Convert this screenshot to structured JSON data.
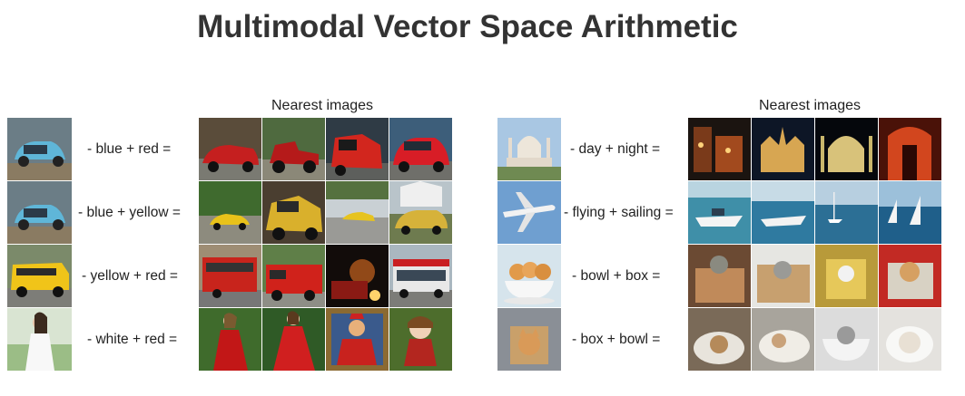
{
  "title": "Multimodal Vector Space Arithmetic",
  "panels": [
    {
      "header": "Nearest images",
      "rows": [
        {
          "query_icon": "blue-car-photo",
          "expression": "- blue + red =",
          "results": [
            "red-classic-car-photo",
            "red-hotrod-photo",
            "red-truck-photo",
            "red-hatchback-photo"
          ]
        },
        {
          "query_icon": "blue-car-photo",
          "expression": "- blue + yellow =",
          "results": [
            "yellow-car-forest-photo",
            "yellow-vintage-car-photo",
            "yellow-sports-car-photo",
            "yellow-suv-photo"
          ]
        },
        {
          "query_icon": "yellow-school-bus-photo",
          "expression": "- yellow + red =",
          "results": [
            "red-bus-street-photo",
            "red-firetruck-photo",
            "firetruck-night-photo",
            "red-city-bus-photo"
          ]
        },
        {
          "query_icon": "woman-white-dress-photo",
          "expression": "- white + red =",
          "results": [
            "woman-red-dress-photo",
            "woman-red-gown-photo",
            "portrait-red-painting",
            "doll-red-dress-photo"
          ]
        }
      ]
    },
    {
      "header": "Nearest images",
      "rows": [
        {
          "query_icon": "taj-mahal-day-photo",
          "expression": "- day + night =",
          "results": [
            "city-night-photo",
            "cathedral-night-photo",
            "palace-night-photo",
            "red-lit-hall-photo"
          ]
        },
        {
          "query_icon": "airplane-flying-photo",
          "expression": "- flying + sailing =",
          "results": [
            "motorboat-photo",
            "speedboat-photo",
            "sailboat-sea-photo",
            "sailboats-blue-photo"
          ]
        },
        {
          "query_icon": "kittens-in-bowl-photo",
          "expression": "- bowl + box =",
          "results": [
            "cat-in-box-photo",
            "cat-cardboard-photo",
            "kitten-yellow-box-photo",
            "cat-red-box-photo"
          ]
        },
        {
          "query_icon": "cat-in-box-photo",
          "expression": "- box + bowl =",
          "results": [
            "cat-sink-photo",
            "cat-basin-photo",
            "kitten-bowl-photo",
            "white-cat-bowl-photo"
          ]
        }
      ]
    }
  ]
}
